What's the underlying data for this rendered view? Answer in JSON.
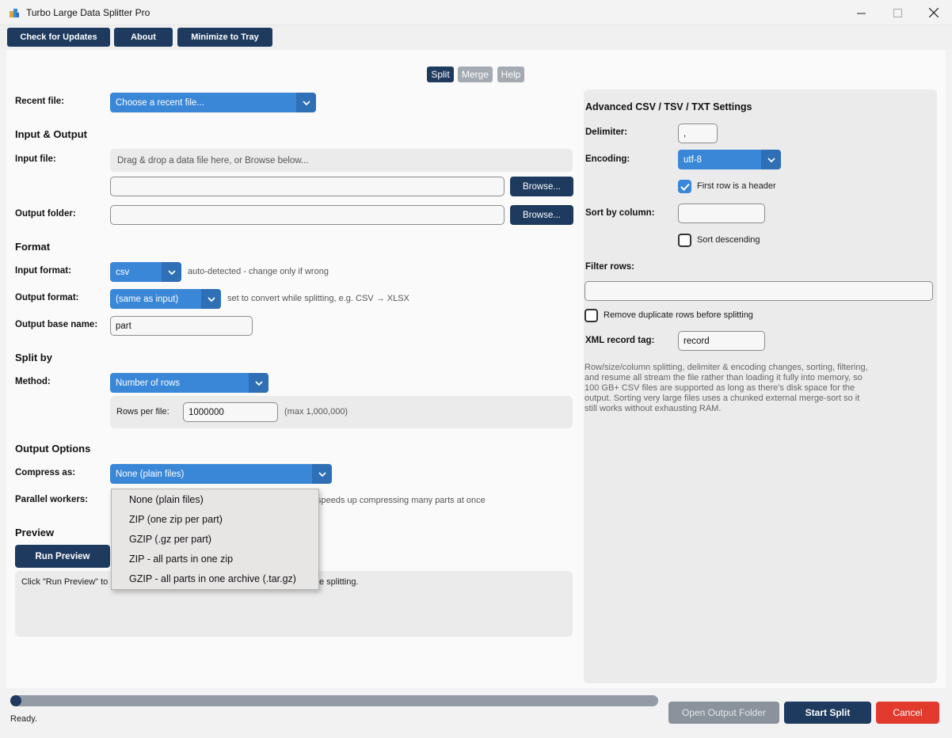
{
  "window": {
    "title": "Turbo Large Data Splitter Pro",
    "minimize": "—",
    "maximize": "☐",
    "close": "✕"
  },
  "toolbar": {
    "check_updates": "Check for Updates",
    "about": "About",
    "minimize_tray": "Minimize to Tray"
  },
  "tabs": {
    "split": "Split",
    "merge": "Merge",
    "help": "Help",
    "active": "Split"
  },
  "left": {
    "recent_label": "Recent file:",
    "recent_value": "Choose a recent file...",
    "io_heading": "Input & Output",
    "input_label": "Input file:",
    "drop_text": "Drag & drop a data file here, or Browse below...",
    "input_value": "",
    "browse": "Browse...",
    "output_label": "Output folder:",
    "output_value": "",
    "format_heading": "Format",
    "input_format_label": "Input format:",
    "input_format_value": "csv",
    "input_format_hint": "auto-detected - change only if wrong",
    "output_format_label": "Output format:",
    "output_format_value": "(same as input)",
    "output_format_hint": "set to convert while splitting, e.g. CSV → XLSX",
    "base_name_label": "Output base name:",
    "base_name_value": "part",
    "split_heading": "Split by",
    "method_label": "Method:",
    "method_value": "Number of rows",
    "rows_label": "Rows per file:",
    "rows_value": "1000000",
    "rows_hint": "(max 1,000,000)",
    "output_options_heading": "Output Options",
    "compress_label": "Compress as:",
    "compress_value": "None (plain files)",
    "workers_label": "Parallel workers:",
    "workers_hint": "speeds up compressing many parts at once",
    "preview_heading": "Preview",
    "run_preview": "Run Preview",
    "preview_text_start": "Click \"Run Preview\" to",
    "preview_text_end": "e splitting."
  },
  "compress_menu": [
    "None (plain files)",
    "ZIP (one zip per part)",
    "GZIP (.gz per part)",
    "ZIP - all parts in one zip",
    "GZIP - all parts in one archive (.tar.gz)"
  ],
  "right": {
    "heading": "Advanced CSV / TSV / TXT Settings",
    "delimiter_label": "Delimiter:",
    "delimiter_value": ",",
    "encoding_label": "Encoding:",
    "encoding_value": "utf-8",
    "header_check_label": "First row is a header",
    "header_checked": true,
    "sort_label": "Sort by column:",
    "sort_value": "",
    "sort_desc_label": "Sort descending",
    "sort_desc_checked": false,
    "filter_label": "Filter rows:",
    "filter_value": "",
    "dedupe_label": "Remove duplicate rows before splitting",
    "dedupe_checked": false,
    "xml_label": "XML record tag:",
    "xml_value": "record",
    "note_lines": [
      "Row/size/column splitting, delimiter & encoding changes, sorting, filtering,",
      "and resume all stream the file rather than loading it fully into memory, so",
      "100 GB+ CSV files are supported as long as there's disk space for the",
      "output. Sorting very large files uses a chunked external merge-sort so it",
      "still works without exhausting RAM."
    ]
  },
  "bottom": {
    "progress": 0.0,
    "status": "Ready.",
    "open_folder": "Open Output Folder",
    "start": "Start Split",
    "cancel": "Cancel"
  },
  "colors": {
    "navy": "#1e3a5f",
    "blue": "#3a87d8",
    "red": "#e33a2e",
    "gray_btn": "#8a929c"
  }
}
